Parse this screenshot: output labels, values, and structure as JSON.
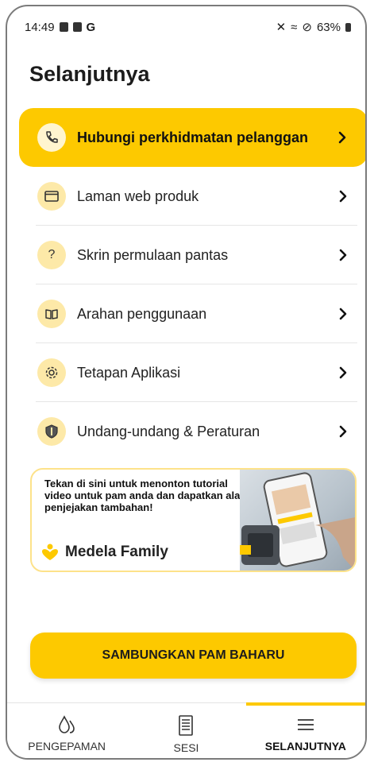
{
  "status_bar": {
    "time": "14:49",
    "carrier_letter": "G",
    "battery": "63%"
  },
  "page": {
    "title": "Selanjutnya"
  },
  "menu": {
    "items": [
      {
        "label": "Hubungi perkhidmatan pelanggan",
        "icon": "phone-icon",
        "active": true
      },
      {
        "label": "Laman web produk",
        "icon": "browser-icon"
      },
      {
        "label": "Skrin permulaan pantas",
        "icon": "question-icon"
      },
      {
        "label": "Arahan penggunaan",
        "icon": "book-icon"
      },
      {
        "label": "Tetapan Aplikasi",
        "icon": "gear-icon"
      },
      {
        "label": "Undang-undang & Peraturan",
        "icon": "shield-icon"
      }
    ]
  },
  "banner": {
    "text": "Tekan di sini untuk menonton tutorial video untuk pam anda dan dapatkan alat penjejakan tambahan!",
    "brand": "Medela Family"
  },
  "cta": {
    "label": "SAMBUNGKAN PAM BAHARU"
  },
  "tabs": [
    {
      "label": "PENGEPAMAN",
      "icon": "drops-icon"
    },
    {
      "label": "SESI",
      "icon": "notes-icon"
    },
    {
      "label": "SELANJUTNYA",
      "icon": "menu-icon",
      "selected": true
    }
  ],
  "colors": {
    "accent": "#fdc900",
    "icon_bg": "#fde9a8"
  }
}
